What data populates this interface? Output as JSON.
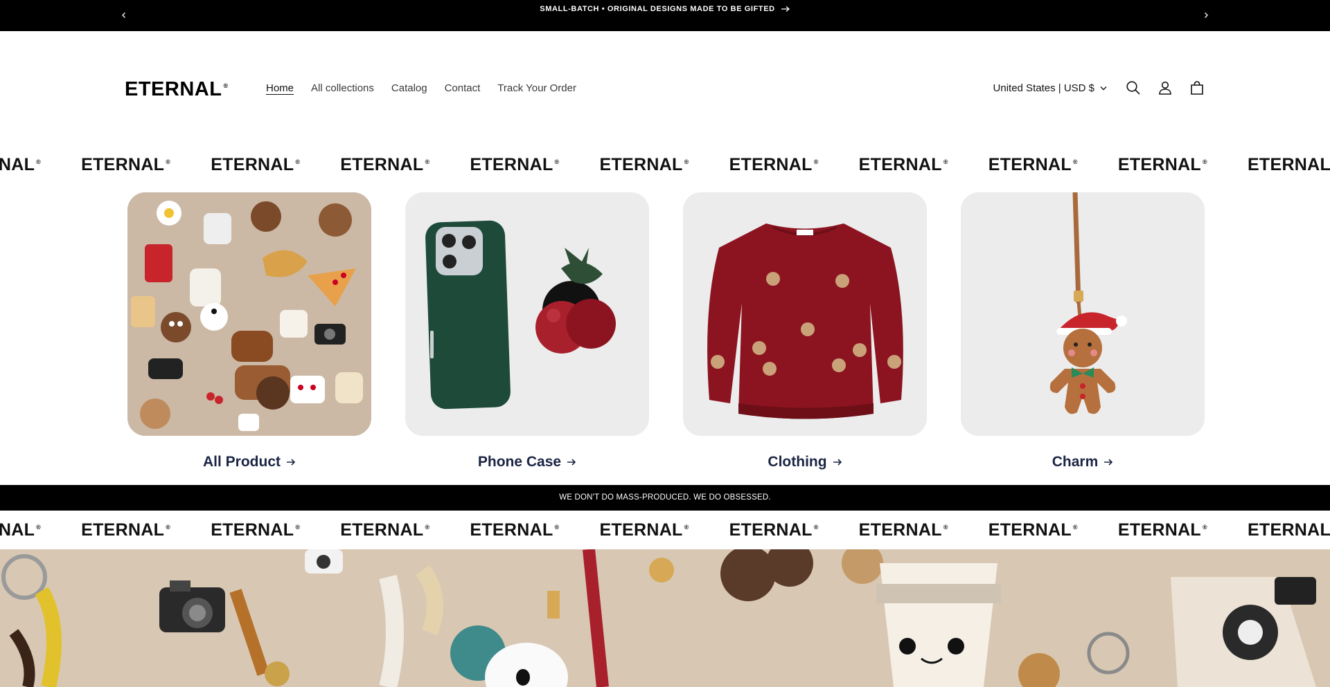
{
  "announcement": {
    "text": "SMALL-BATCH • ORIGINAL DESIGNS MADE TO BE GIFTED"
  },
  "header": {
    "logo": "ETERNAL",
    "nav": [
      {
        "label": "Home"
      },
      {
        "label": "All collections"
      },
      {
        "label": "Catalog"
      },
      {
        "label": "Contact"
      },
      {
        "label": "Track Your Order"
      }
    ],
    "country_selector": "United States | USD $"
  },
  "marquee": {
    "brand": "ETERNAL",
    "repeat": [
      "ETERNAL",
      "ETERNAL",
      "ETERNAL",
      "ETERNAL",
      "ETERNAL",
      "ETERNAL",
      "ETERNAL",
      "ETERNAL",
      "ETERNAL",
      "ETERNAL",
      "ETERNAL"
    ]
  },
  "categories": [
    {
      "title": "All Product"
    },
    {
      "title": "Phone Case"
    },
    {
      "title": "Clothing"
    },
    {
      "title": "Charm"
    }
  ],
  "strip": {
    "text": "WE DON'T DO MASS-PRODUCED. WE DO OBSESSED."
  },
  "colors": {
    "bar_bg": "#000000",
    "category_title": "#1b2544",
    "sweater": "#8c1420",
    "phone_case": "#1e4a3a"
  }
}
